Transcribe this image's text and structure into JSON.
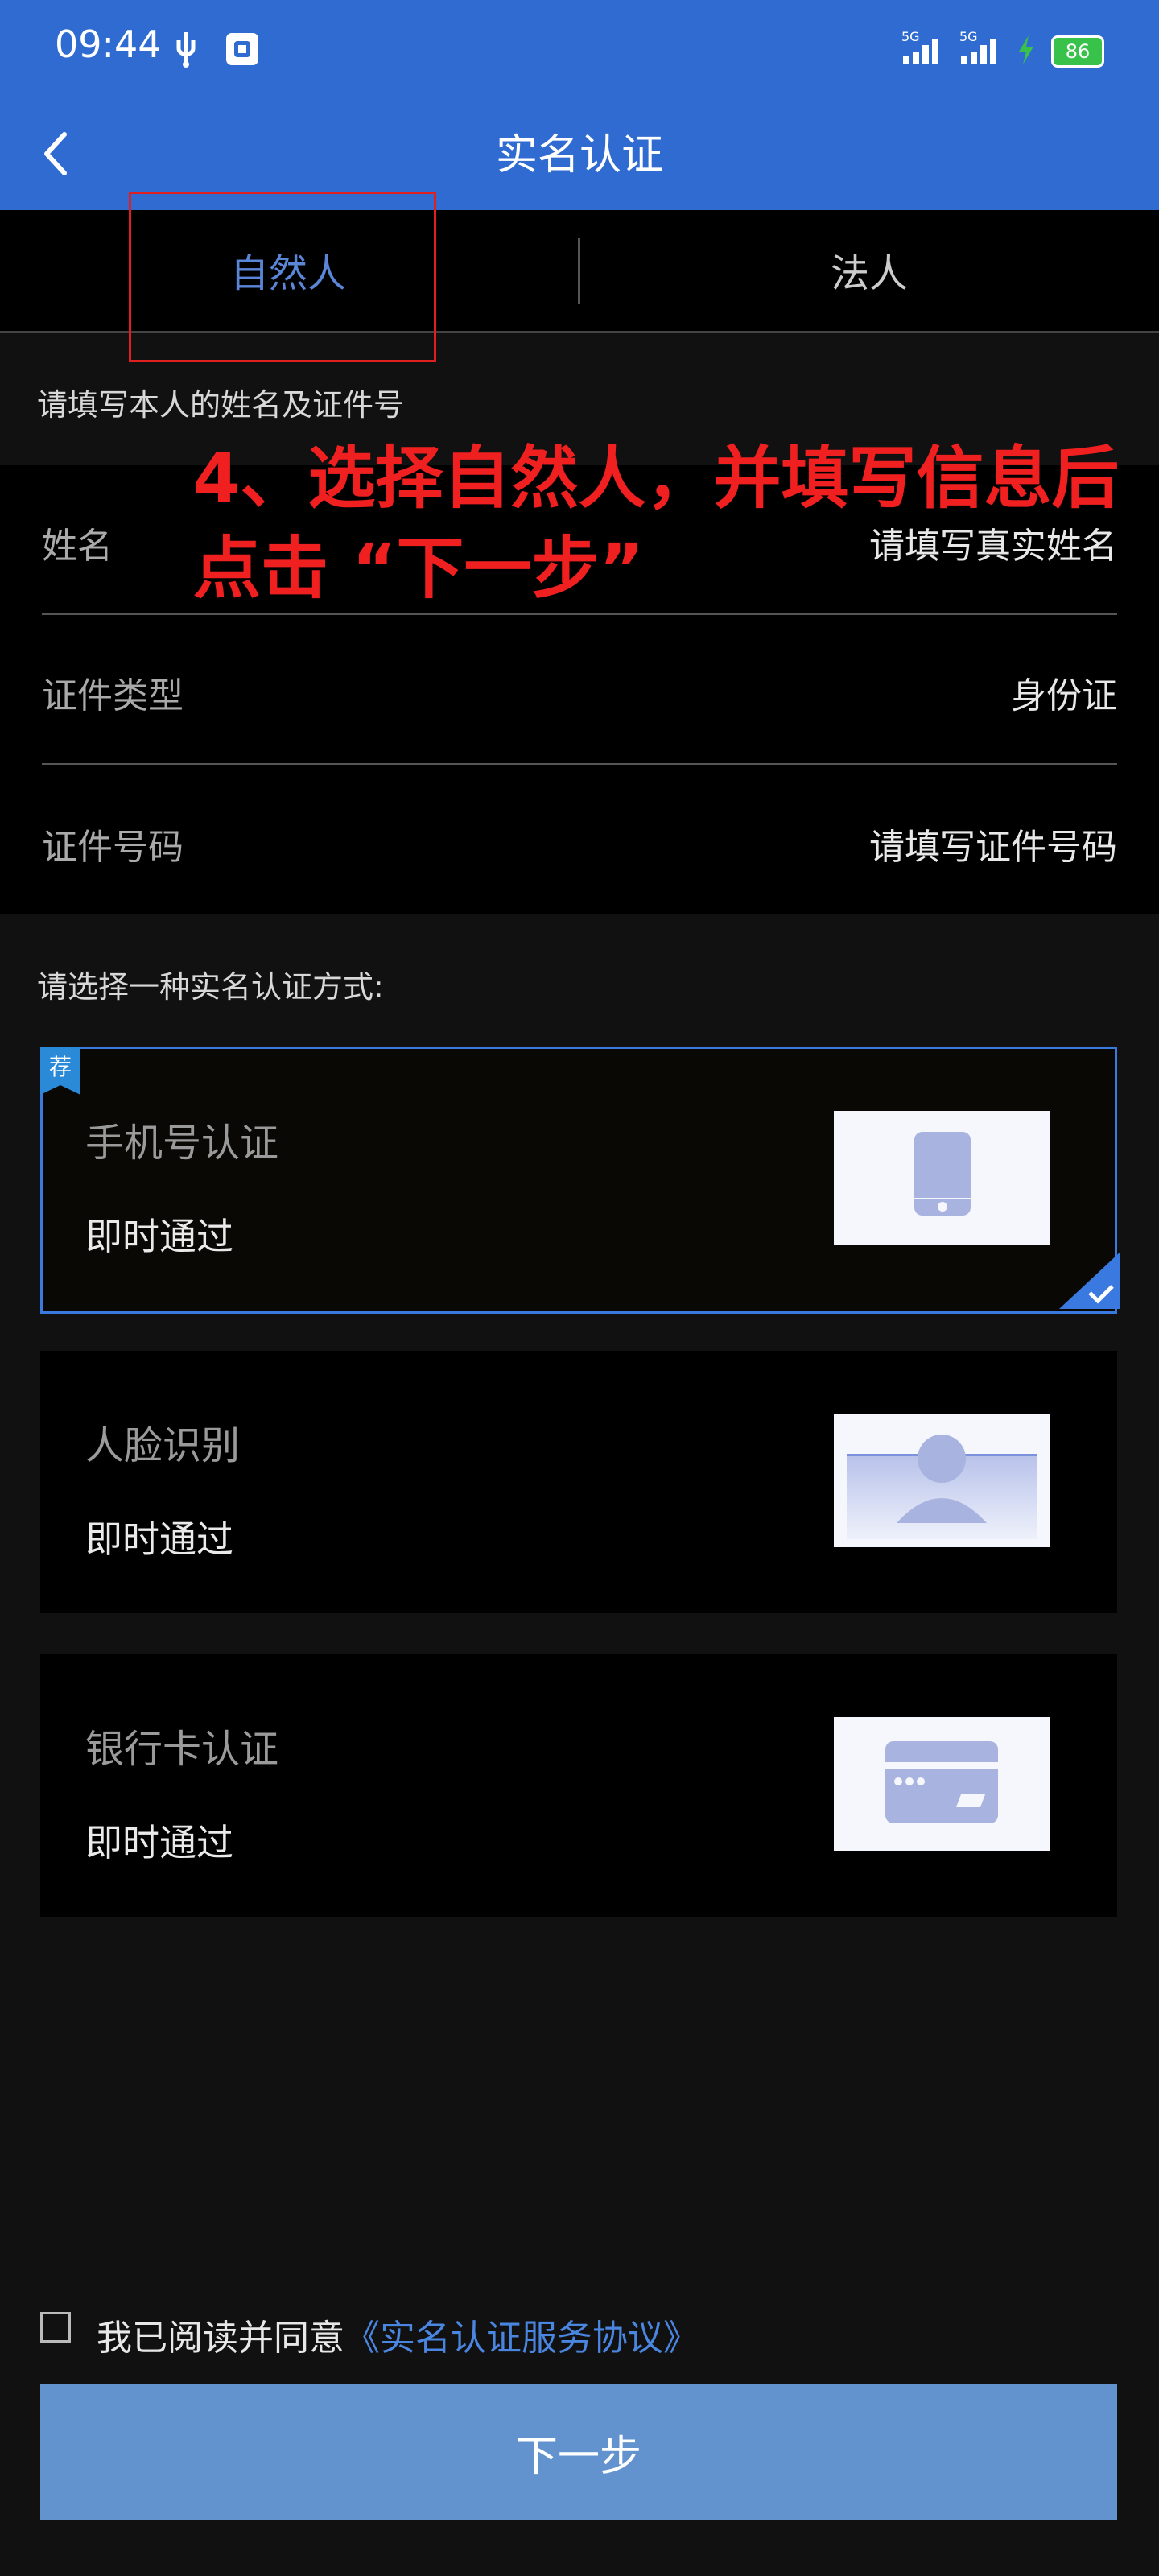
{
  "status_bar": {
    "time": "09:44",
    "network_1": "5G",
    "network_2": "5G",
    "battery": "86"
  },
  "header": {
    "title": "实名认证"
  },
  "tabs": [
    {
      "label": "自然人",
      "active": true
    },
    {
      "label": "法人",
      "active": false
    }
  ],
  "hint": "请填写本人的姓名及证件号",
  "annotation": {
    "line1": "4、选择自然人，并填写信息后",
    "line2": "点击 “下一步”"
  },
  "form": {
    "name": {
      "label": "姓名",
      "placeholder": "请填写真实姓名"
    },
    "id_type": {
      "label": "证件类型",
      "value": "身份证"
    },
    "id_number": {
      "label": "证件号码",
      "placeholder": "请填写证件号码"
    }
  },
  "method_prompt": "请选择一种实名认证方式:",
  "methods": [
    {
      "title": "手机号认证",
      "subtitle": "即时通过",
      "badge": "荐",
      "selected": true,
      "icon": "phone-icon"
    },
    {
      "title": "人脸识别",
      "subtitle": "即时通过",
      "selected": false,
      "icon": "face-icon"
    },
    {
      "title": "银行卡认证",
      "subtitle": "即时通过",
      "selected": false,
      "icon": "bank-card-icon"
    }
  ],
  "agreement": {
    "prefix": "我已阅读并同意",
    "link": "《实名认证服务协议》",
    "checked": false
  },
  "next_button": "下一步",
  "colors": {
    "header": "#2f6bd0",
    "accent": "#3a7ae0",
    "annotation": "#f02020",
    "button": "#6293cf"
  }
}
